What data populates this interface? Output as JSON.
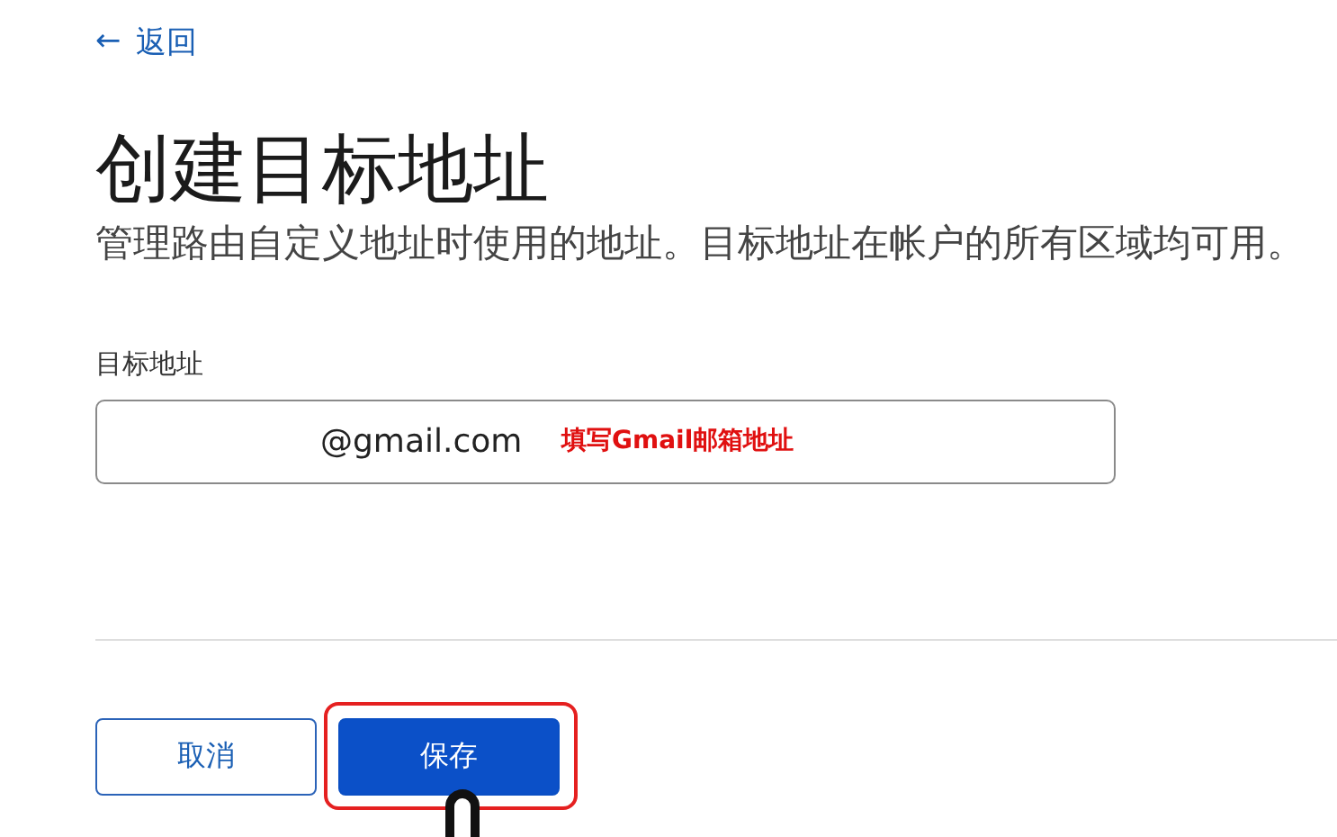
{
  "back_link": {
    "arrow": "←",
    "label": "返回"
  },
  "title": "创建目标地址",
  "description": "管理路由自定义地址时使用的地址。目标地址在帐户的所有区域均可用。",
  "field": {
    "label": "目标地址",
    "value": "@gmail.com",
    "annotation": "填写Gmail邮箱地址"
  },
  "buttons": [
    {
      "label": "取消",
      "kind": "secondary",
      "highlighted": false
    },
    {
      "label": "保存",
      "kind": "primary",
      "highlighted": true
    }
  ]
}
